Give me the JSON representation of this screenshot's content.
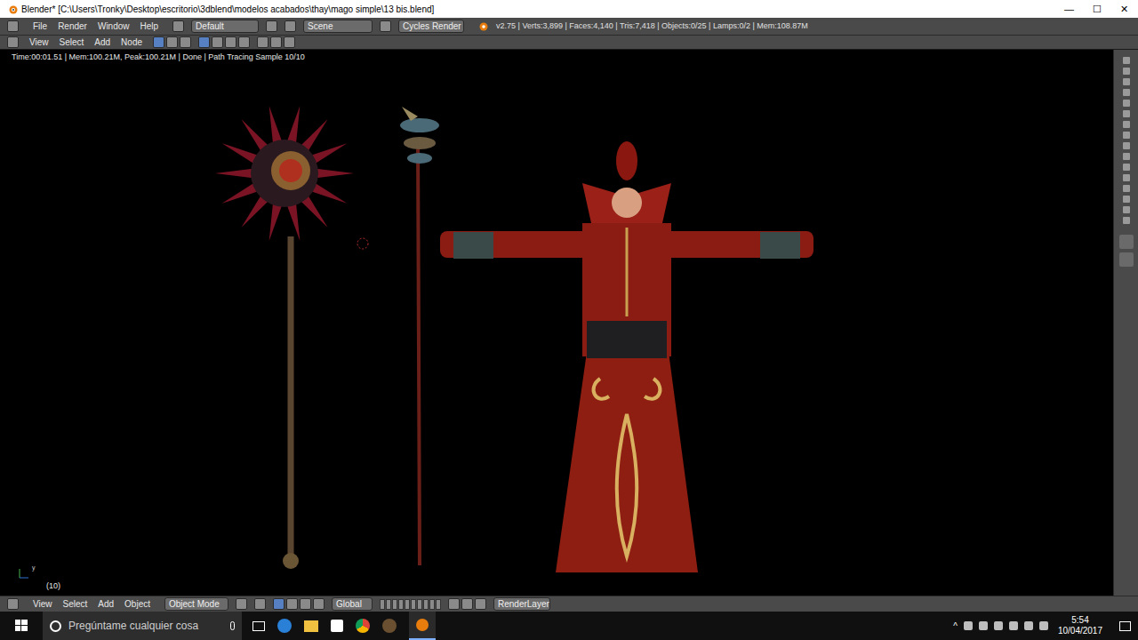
{
  "window": {
    "title": "Blender* [C:\\Users\\Tronky\\Desktop\\escritorio\\3dblend\\modelos acabados\\thay\\mago simple\\13 bis.blend]",
    "controls": [
      "—",
      "☐",
      "✕"
    ]
  },
  "info_header": {
    "menus": [
      "File",
      "Render",
      "Window",
      "Help"
    ],
    "layout": "Default",
    "scene": "Scene",
    "engine": "Cycles Render",
    "stats": "v2.75 | Verts:3,899 | Faces:4,140 | Tris:7,418 | Objects:0/25 | Lamps:0/2 | Mem:108.87M"
  },
  "view_header": {
    "menus": [
      "View",
      "Select",
      "Add",
      "Node"
    ]
  },
  "viewport": {
    "render_info": "Time:00:01.51 | Mem:100.21M, Peak:100.21M | Done | Path Tracing Sample 10/10",
    "frame": "(10)",
    "axis_label": "y"
  },
  "bottom_header": {
    "menus": [
      "View",
      "Select",
      "Add",
      "Object"
    ],
    "mode": "Object Mode",
    "orientation": "Global",
    "render_layer": "RenderLayer"
  },
  "taskbar": {
    "search_placeholder": "Pregúntame cualquier cosa",
    "time": "5:54",
    "date": "10/04/2017"
  }
}
